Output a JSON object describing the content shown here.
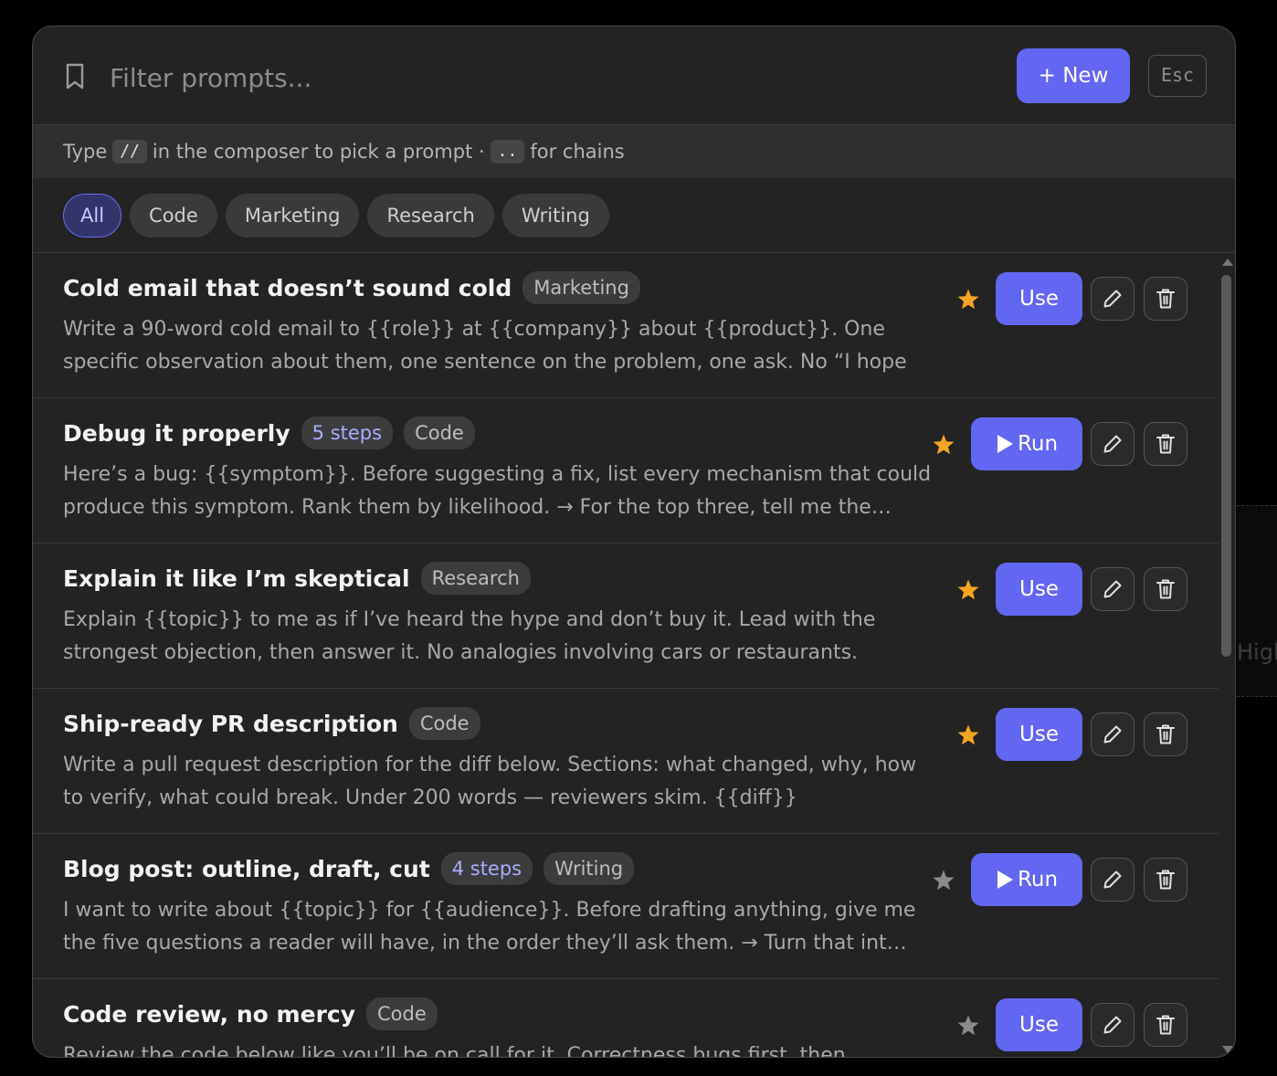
{
  "search": {
    "placeholder": "Filter prompts..."
  },
  "toolbar": {
    "new_label": "+ New",
    "esc_label": "Esc"
  },
  "hint": {
    "prefix": "Type",
    "key1": "//",
    "middle": "in the composer to pick a prompt ·",
    "key2": "..",
    "suffix": "for chains"
  },
  "filters": [
    {
      "label": "All",
      "active": true
    },
    {
      "label": "Code",
      "active": false
    },
    {
      "label": "Marketing",
      "active": false
    },
    {
      "label": "Research",
      "active": false
    },
    {
      "label": "Writing",
      "active": false
    }
  ],
  "prompts": [
    {
      "title": "Cold email that doesn’t sound cold",
      "steps": "",
      "tag": "Marketing",
      "body": "Write a 90-word cold email to {{role}} at {{company}} about {{product}}. One specific observation about them, one sentence on the problem, one ask. No “I hope this find…",
      "starred": true,
      "action": "Use"
    },
    {
      "title": "Debug it properly",
      "steps": "5 steps",
      "tag": "Code",
      "body": "Here’s a bug: {{symptom}}. Before suggesting a fix, list every mechanism that could produce this symptom. Rank them by likelihood. → For the top three, tell me the…",
      "starred": true,
      "action": "Run"
    },
    {
      "title": "Explain it like I’m skeptical",
      "steps": "",
      "tag": "Research",
      "body": "Explain {{topic}} to me as if I’ve heard the hype and don’t buy it. Lead with the strongest objection, then answer it. No analogies involving cars or restaurants.",
      "starred": true,
      "action": "Use"
    },
    {
      "title": "Ship-ready PR description",
      "steps": "",
      "tag": "Code",
      "body": "Write a pull request description for the diff below. Sections: what changed, why, how to verify, what could break. Under 200 words — reviewers skim. {{diff}}",
      "starred": true,
      "action": "Use"
    },
    {
      "title": "Blog post: outline, draft, cut",
      "steps": "4 steps",
      "tag": "Writing",
      "body": "I want to write about {{topic}} for {{audience}}. Before drafting anything, give me the five questions a reader will have, in the order they’ll ask them. → Turn that int…",
      "starred": false,
      "action": "Run"
    },
    {
      "title": "Code review, no mercy",
      "steps": "",
      "tag": "Code",
      "body": "Review the code below like you’ll be on call for it. Correctness bugs first, then",
      "starred": false,
      "action": "Use"
    }
  ],
  "background_peek": "High",
  "colors": {
    "accent": "#6366f1",
    "star_on": "#f5a524",
    "star_off": "#8a8a8a",
    "panel": "#232323"
  }
}
